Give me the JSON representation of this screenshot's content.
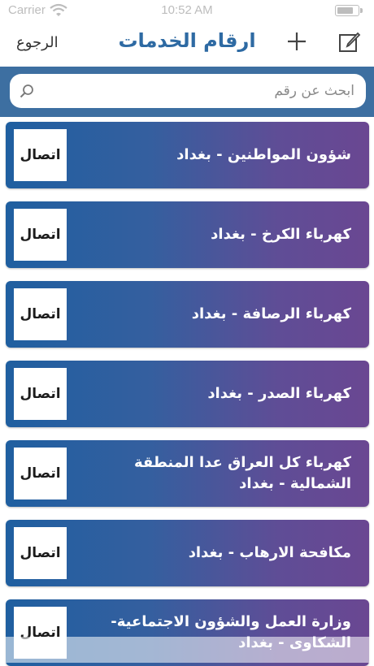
{
  "status_bar": {
    "carrier": "Carrier",
    "time": "10:52 AM"
  },
  "nav": {
    "title": "ارقام الخدمات",
    "back_label": "الرجوع"
  },
  "search": {
    "placeholder": "ابحث عن رقم",
    "value": ""
  },
  "call_label": "اتصال",
  "services": [
    {
      "name": "شؤون المواطنين - بغداد"
    },
    {
      "name": "كهرباء الكرخ - بغداد"
    },
    {
      "name": "كهرباء الرصافة - بغداد"
    },
    {
      "name": "كهرباء الصدر - بغداد"
    },
    {
      "name": "كهرباء كل العراق عدا المنطقة الشمالية - بغداد"
    },
    {
      "name": "مكافحة الارهاب - بغداد"
    },
    {
      "name": "وزارة العمل والشؤون الاجتماعية- الشكاوى - بغداد"
    }
  ],
  "colors": {
    "accent": "#2e6aa3",
    "search_bg": "#3d6fa1",
    "card_start": "#1f5fa0",
    "card_end": "#6a4792"
  },
  "icons": {
    "edit": "compose-icon",
    "add": "plus-icon",
    "search": "search-icon",
    "wifi": "wifi-icon",
    "battery": "battery-icon"
  }
}
